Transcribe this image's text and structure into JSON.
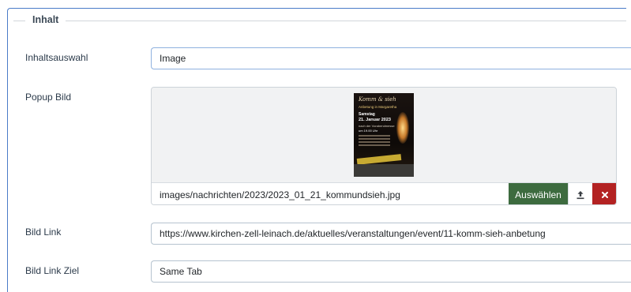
{
  "fieldset": {
    "legend": "Inhalt"
  },
  "content_selection": {
    "label": "Inhaltsauswahl",
    "value": "Image"
  },
  "popup_image": {
    "label": "Popup Bild",
    "path": "images/nachrichten/2023/2023_01_21_kommundsieh.jpg",
    "select_label": "Auswählen",
    "upload_icon": "upload-icon",
    "clear_icon": "close-icon",
    "poster": {
      "title": "Komm & sieh",
      "subtitle": "Anbetung in Margaretha",
      "day": "Samstag",
      "date": "21. Januar 2023",
      "place": "nach der Vorabendmesse",
      "time": "um 19.00 Uhr"
    }
  },
  "image_link": {
    "label": "Bild Link",
    "value": "https://www.kirchen-zell-leinach.de/aktuelles/veranstaltungen/event/11-komm-sieh-anbetung"
  },
  "image_link_target": {
    "label": "Bild Link Ziel",
    "value": "Same Tab"
  },
  "colors": {
    "select_button": "#3d6b3f",
    "clear_button": "#b32222",
    "frame_border": "#4a7bc8"
  }
}
